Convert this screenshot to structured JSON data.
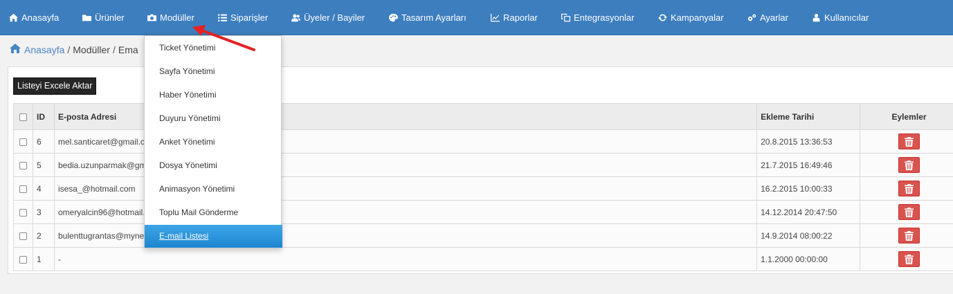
{
  "nav": {
    "items": [
      {
        "label": "Anasayfa",
        "icon": "home-icon"
      },
      {
        "label": "Ürünler",
        "icon": "folder-icon"
      },
      {
        "label": "Modüller",
        "icon": "module-icon"
      },
      {
        "label": "Siparişler",
        "icon": "list-icon"
      },
      {
        "label": "Üyeler / Bayiler",
        "icon": "users-icon"
      },
      {
        "label": "Tasarım Ayarları",
        "icon": "palette-icon"
      },
      {
        "label": "Raporlar",
        "icon": "chart-icon"
      },
      {
        "label": "Entegrasyonlar",
        "icon": "integration-icon"
      },
      {
        "label": "Kampanyalar",
        "icon": "refresh-icon"
      },
      {
        "label": "Ayarlar",
        "icon": "gears-icon"
      },
      {
        "label": "Kullanıcılar",
        "icon": "user-icon"
      }
    ]
  },
  "breadcrumb": {
    "home": "Anasayfa",
    "sep1": "/",
    "modules": "Modüller",
    "sep2": "/",
    "current": "Ema"
  },
  "toolbar": {
    "export_label": "Listeyi Excele Aktar"
  },
  "table": {
    "headers": {
      "id": "ID",
      "email": "E-posta Adresi",
      "date": "Ekleme Tarihi",
      "actions": "Eylemler"
    },
    "rows": [
      {
        "id": "6",
        "email": "mel.santicaret@gmail.c",
        "date": "20.8.2015 13:36:53"
      },
      {
        "id": "5",
        "email": "bedia.uzunparmak@gm",
        "date": "21.7.2015 16:49:46"
      },
      {
        "id": "4",
        "email": "isesa_@hotmail.com",
        "date": "16.2.2015 10:00:33"
      },
      {
        "id": "3",
        "email": "omeryalcin96@hotmail.",
        "date": "14.12.2014 20:47:50"
      },
      {
        "id": "2",
        "email": "bulenttugrantas@mynet",
        "date": "14.9.2014 08:00:22"
      },
      {
        "id": "1",
        "email": "-",
        "date": "1.1.2000 00:00:00"
      }
    ]
  },
  "dropdown": {
    "items": [
      {
        "label": "Ticket Yönetimi",
        "active": false
      },
      {
        "label": "Sayfa Yönetimi",
        "active": false
      },
      {
        "label": "Haber Yönetimi",
        "active": false
      },
      {
        "label": "Duyuru Yönetimi",
        "active": false
      },
      {
        "label": "Anket Yönetimi",
        "active": false
      },
      {
        "label": "Dosya Yönetimi",
        "active": false
      },
      {
        "label": "Animasyon Yönetimi",
        "active": false
      },
      {
        "label": "Toplu Mail Gönderme",
        "active": false
      },
      {
        "label": "E-mail Listesi",
        "active": true
      }
    ]
  },
  "colors": {
    "navbar": "#3d7ebf",
    "delete": "#d9534f",
    "active_item": "#1f8bd3",
    "annotation_arrow": "#e52222"
  }
}
